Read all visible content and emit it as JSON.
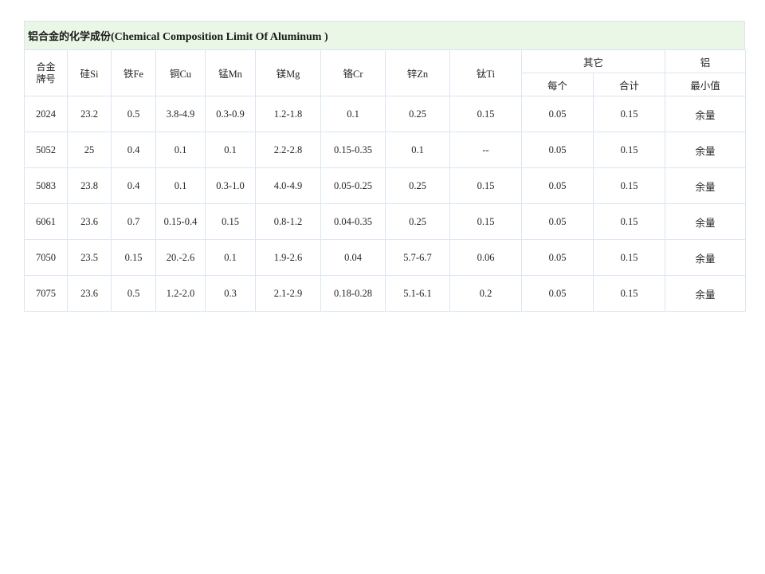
{
  "document": {
    "title_cn": "铝合金的化学成份",
    "title_en": "(Chemical Composition Limit Of Aluminum )"
  },
  "table": {
    "headers": {
      "grade": {
        "line1": "合金",
        "line2": "牌号"
      },
      "si": "硅Si",
      "fe": "铁Fe",
      "cu": "铜Cu",
      "mn": "锰Mn",
      "mg": "镁Mg",
      "cr": "铬Cr",
      "zn": "锌Zn",
      "ti": "钛Ti",
      "others_group": "其它",
      "others_each": "每个",
      "others_total": "合计",
      "aluminum_group": "铝",
      "aluminum_min": "最小值"
    },
    "rows": [
      {
        "grade": "2024",
        "si": "23.2",
        "fe": "0.5",
        "cu": "3.8-4.9",
        "mn": "0.3-0.9",
        "mg": "1.2-1.8",
        "cr": "0.1",
        "zn": "0.25",
        "ti": "0.15",
        "others_each": "0.05",
        "others_total": "0.15",
        "aluminum_min": "余量"
      },
      {
        "grade": "5052",
        "si": "25",
        "fe": "0.4",
        "cu": "0.1",
        "mn": "0.1",
        "mg": "2.2-2.8",
        "cr": "0.15-0.35",
        "zn": "0.1",
        "ti": "--",
        "others_each": "0.05",
        "others_total": "0.15",
        "aluminum_min": "余量"
      },
      {
        "grade": "5083",
        "si": "23.8",
        "fe": "0.4",
        "cu": "0.1",
        "mn": "0.3-1.0",
        "mg": "4.0-4.9",
        "cr": "0.05-0.25",
        "zn": "0.25",
        "ti": "0.15",
        "others_each": "0.05",
        "others_total": "0.15",
        "aluminum_min": "余量"
      },
      {
        "grade": "6061",
        "si": "23.6",
        "fe": "0.7",
        "cu": "0.15-0.4",
        "mn": "0.15",
        "mg": "0.8-1.2",
        "cr": "0.04-0.35",
        "zn": "0.25",
        "ti": "0.15",
        "others_each": "0.05",
        "others_total": "0.15",
        "aluminum_min": "余量"
      },
      {
        "grade": "7050",
        "si": "23.5",
        "fe": "0.15",
        "cu": "20.-2.6",
        "mn": "0.1",
        "mg": "1.9-2.6",
        "cr": "0.04",
        "zn": "5.7-6.7",
        "ti": "0.06",
        "others_each": "0.05",
        "others_total": "0.15",
        "aluminum_min": "余量"
      },
      {
        "grade": "7075",
        "si": "23.6",
        "fe": "0.5",
        "cu": "1.2-2.0",
        "mn": "0.3",
        "mg": "2.1-2.9",
        "cr": "0.18-0.28",
        "zn": "5.1-6.1",
        "ti": "0.2",
        "others_each": "0.05",
        "others_total": "0.15",
        "aluminum_min": "余量"
      }
    ]
  },
  "colors": {
    "title_background": "#eaf7e6",
    "grid_border": "#dbe5f1",
    "text": "#262626",
    "page_background": "#ffffff"
  }
}
